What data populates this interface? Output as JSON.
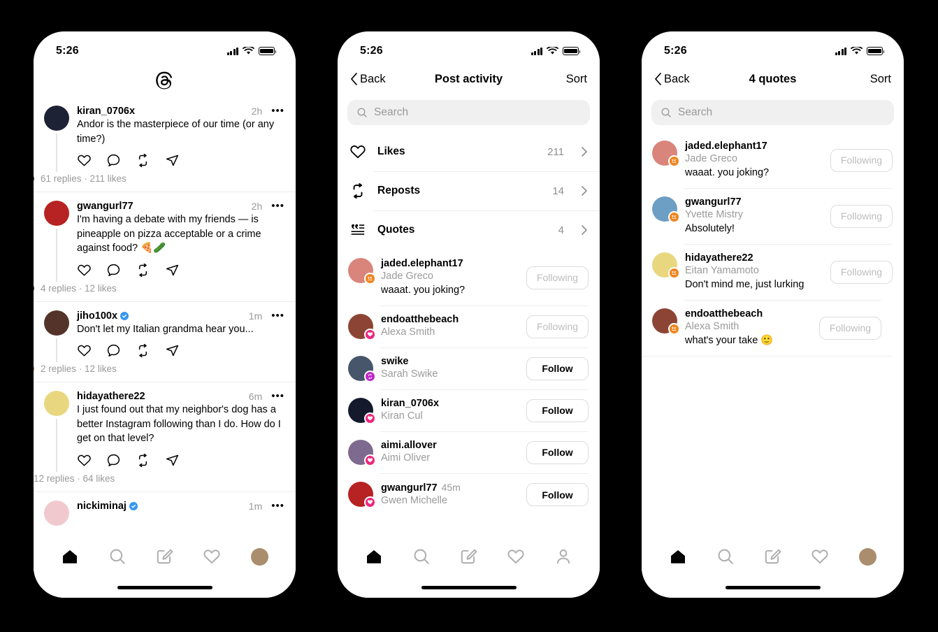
{
  "statusbar": {
    "time": "5:26",
    "signal_icon": "cellular-bars-icon",
    "wifi_icon": "wifi-icon",
    "battery_icon": "battery-full-icon"
  },
  "colors": {
    "accent_verified": "#3897f0",
    "badge_quote": "#f0851f",
    "badge_like": "#f0247b",
    "badge_repost": "#c026c8",
    "text_primary": "#000000",
    "text_secondary": "#999999",
    "divider": "#ededed",
    "search_bg": "#f0f0f0"
  },
  "screen1": {
    "logo_icon": "threads-logo-icon",
    "posts": [
      {
        "username": "kiran_0706x",
        "verified": false,
        "time": "2h",
        "text": "Andor is the masterpiece of our time (or any time?)",
        "meta": "61 replies · 211 likes",
        "facepile": 2,
        "avatar_color": "#1d2234",
        "faces": [
          "#3c3730",
          "#584538"
        ]
      },
      {
        "username": "gwangurl77",
        "verified": false,
        "time": "2h",
        "text": "I'm having a debate with my friends — is pineapple on pizza acceptable or a crime against food? 🍕🥒",
        "meta": "4 replies · 12 likes",
        "facepile": 2,
        "avatar_color": "#b62322",
        "faces": [
          "#6f5b4e",
          "#3b3632"
        ]
      },
      {
        "username": "jiho100x",
        "verified": true,
        "time": "1m",
        "text": "Don't let my Italian grandma hear you...",
        "meta": "2 replies · 12 likes",
        "facepile": 2,
        "avatar_color": "#54332a",
        "faces": [
          "#c08d6e",
          "#b87f63"
        ]
      },
      {
        "username": "hidayathere22",
        "verified": false,
        "time": "6m",
        "text": "I just found out that my neighbor's dog has a better Instagram following than I do. How do I get on that level?",
        "meta": "12 replies · 64 likes",
        "facepile": 1,
        "avatar_color": "#e8d77f",
        "faces": [
          "#6a5a4c"
        ]
      },
      {
        "username": "nickiminaj",
        "verified": true,
        "time": "1m",
        "text": "",
        "meta": "",
        "facepile": 0,
        "avatar_color": "#f0c9cf",
        "faces": []
      }
    ],
    "action_icons": [
      "heart-icon",
      "comment-icon",
      "repost-icon",
      "share-icon"
    ]
  },
  "screen2": {
    "nav": {
      "back_label": "Back",
      "title": "Post activity",
      "sort_label": "Sort",
      "back_icon": "chevron-left-icon"
    },
    "search": {
      "placeholder": "Search",
      "icon": "search-icon"
    },
    "activity_rows": [
      {
        "icon": "heart-icon",
        "label": "Likes",
        "count": "211"
      },
      {
        "icon": "repost-icon",
        "label": "Reposts",
        "count": "14"
      },
      {
        "icon": "quote-icon",
        "label": "Quotes",
        "count": "4"
      }
    ],
    "users": [
      {
        "username": "jaded.elephant17",
        "name": "Jade Greco",
        "time": "",
        "quote": "waaat. you joking?",
        "button": "Following",
        "following": true,
        "badge": "quote",
        "avatar_color": "#d9857c"
      },
      {
        "username": "endoatthebeach",
        "name": "Alexa Smith",
        "time": "",
        "quote": "",
        "button": "Following",
        "following": true,
        "badge": "like",
        "avatar_color": "#8c4535"
      },
      {
        "username": "swike",
        "name": "Sarah Swike",
        "time": "",
        "quote": "",
        "button": "Follow",
        "following": false,
        "badge": "repost",
        "avatar_color": "#47566b"
      },
      {
        "username": "kiran_0706x",
        "name": "Kiran Cul",
        "time": "",
        "quote": "",
        "button": "Follow",
        "following": false,
        "badge": "like",
        "avatar_color": "#141a2c"
      },
      {
        "username": "aimi.allover",
        "name": "Aimi Oliver",
        "time": "",
        "quote": "",
        "button": "Follow",
        "following": false,
        "badge": "like",
        "avatar_color": "#7e6a8e"
      },
      {
        "username": "gwangurl77",
        "name": "Gwen Michelle",
        "time": "45m",
        "quote": "",
        "button": "Follow",
        "following": false,
        "badge": "like",
        "avatar_color": "#b62322"
      }
    ]
  },
  "screen3": {
    "nav": {
      "back_label": "Back",
      "title": "4 quotes",
      "sort_label": "Sort",
      "back_icon": "chevron-left-icon"
    },
    "search": {
      "placeholder": "Search",
      "icon": "search-icon"
    },
    "users": [
      {
        "username": "jaded.elephant17",
        "name": "Jade Greco",
        "quote": "waaat. you joking?",
        "button": "Following",
        "following": true,
        "badge": "quote",
        "avatar_color": "#d9857c"
      },
      {
        "username": "gwangurl77",
        "name": "Yvette Mistry",
        "quote": "Absolutely!",
        "button": "Following",
        "following": true,
        "badge": "quote",
        "avatar_color": "#6d9ec4"
      },
      {
        "username": "hidayathere22",
        "name": "Eitan Yamamoto",
        "quote": "Don't mind me, just lurking",
        "button": "Following",
        "following": true,
        "badge": "quote",
        "avatar_color": "#e8d77f"
      },
      {
        "username": "endoatthebeach",
        "name": "Alexa Smith",
        "quote": "what's your take 🙂",
        "button": "Following",
        "following": true,
        "badge": "quote",
        "avatar_color": "#8c4535"
      }
    ]
  },
  "tabbar": {
    "items": [
      {
        "icon": "home-icon",
        "label": "Home",
        "active": true
      },
      {
        "icon": "search-icon",
        "label": "Search",
        "active": false
      },
      {
        "icon": "compose-icon",
        "label": "Compose",
        "active": false
      },
      {
        "icon": "heart-icon",
        "label": "Activity",
        "active": false
      },
      {
        "icon": "profile-avatar-icon",
        "label": "Profile",
        "active": false
      }
    ]
  }
}
